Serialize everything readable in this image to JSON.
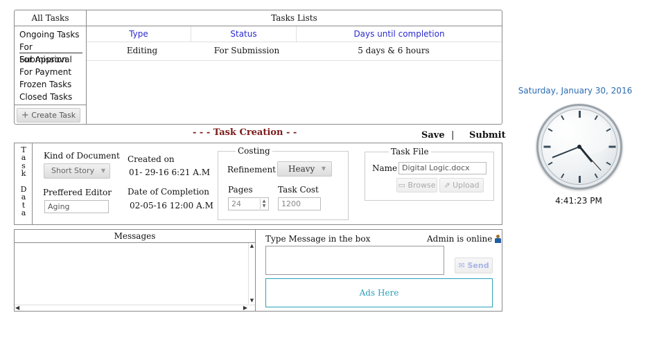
{
  "sidebar": {
    "title": "All Tasks",
    "items": [
      "Ongoing Tasks",
      "For Submission",
      "For Approval",
      "For Payment",
      "Frozen Tasks",
      "Closed Tasks"
    ],
    "create_button": "Create Task"
  },
  "tasks_list": {
    "title": "Tasks Lists",
    "columns": [
      "Type",
      "Status",
      "Days until completion"
    ],
    "rows": [
      {
        "type": "Editing",
        "status": "For Submission",
        "days": "5 days & 6 hours"
      }
    ]
  },
  "creation": {
    "title": "- - - Task Creation - -",
    "save_label": "Save",
    "separator": "|",
    "submit_label": "Submit",
    "side_label": "Task Data"
  },
  "task_data": {
    "kind_label": "Kind of Document",
    "kind_value": "Short Story",
    "editor_label": "Preffered Editor",
    "editor_value": "Aging",
    "created_label": "Created on",
    "created_value": "01- 29-16 6:21 A.M",
    "completion_label": "Date of Completion",
    "completion_value": "02-05-16 12:00 A.M"
  },
  "costing": {
    "title": "Costing",
    "refinement_label": "Refinement",
    "refinement_value": "Heavy",
    "pages_label": "Pages",
    "pages_value": "24",
    "cost_label": "Task Cost",
    "cost_value": "1200"
  },
  "task_file": {
    "title": "Task File",
    "name_label": "Name",
    "name_value": "Digital Logic.docx",
    "browse_label": "Browse",
    "upload_label": "Upload"
  },
  "messages": {
    "title": "Messages",
    "prompt": "Type Message in the box",
    "status": "Admin is online",
    "send_label": "Send",
    "ads": "Ads Here"
  },
  "clock": {
    "date": "Saturday, January 30, 2016",
    "time": "4:41:23 PM",
    "hour": 4,
    "minute": 41,
    "second": 23
  },
  "colors": {
    "accent_red": "#7a1a1a",
    "link_blue": "#2a2ad0",
    "ads_teal": "#2aa0b8",
    "date_blue": "#2a6ab0"
  }
}
